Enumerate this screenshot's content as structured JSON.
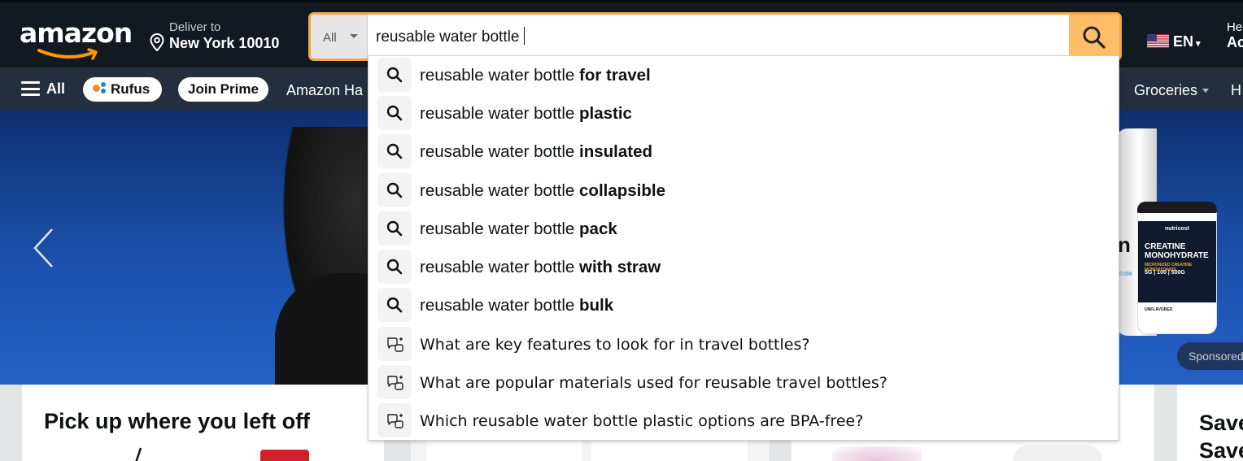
{
  "header": {
    "logo": "amazon",
    "deliver_line1": "Deliver to",
    "deliver_line2": "New York 10010",
    "search_category": "All",
    "search_value": "reusable water bottle",
    "language": "EN",
    "account_line1": "He",
    "account_line2": "Ac"
  },
  "subnav": {
    "all_label": "All",
    "rufus_label": "Rufus",
    "prime_label": "Join Prime",
    "link_amazon": "Amazon Ha",
    "link_groceries": "Groceries",
    "link_cut": "H"
  },
  "hero": {
    "sponsored_label": "Sponsored",
    "product_brand": "nutricost",
    "product_name_1": "CREATINE",
    "product_name_2": "MONOHYDRATE",
    "product_sub": "MICRONIZED CREATINE MONOHYDRATE",
    "product_boxes": "5G | 100 | 500G",
    "product_flavor": "UNFLAVORED",
    "back_tub_letter": "n",
    "back_tub_text": "trate"
  },
  "cards": {
    "card1_title": "Pick up where you left off",
    "card4_title_line1": "Save",
    "card4_title_line2": "Save"
  },
  "suggestions": [
    {
      "base": "reusable water bottle",
      "bold": "for travel",
      "icon": "search-icon"
    },
    {
      "base": "reusable water bottle",
      "bold": "plastic",
      "icon": "search-icon"
    },
    {
      "base": "reusable water bottle",
      "bold": "insulated",
      "icon": "search-icon"
    },
    {
      "base": "reusable water bottle",
      "bold": "collapsible",
      "icon": "search-icon"
    },
    {
      "base": "reusable water bottle",
      "bold": "pack",
      "icon": "search-icon"
    },
    {
      "base": "reusable water bottle",
      "bold": "with straw",
      "icon": "search-icon"
    },
    {
      "base": "reusable water bottle",
      "bold": "bulk",
      "icon": "search-icon"
    }
  ],
  "ai_suggestions": [
    {
      "text": "What are key features to look for in travel bottles?",
      "icon": "rufus-chat-icon"
    },
    {
      "text": "What are popular materials used for reusable travel bottles?",
      "icon": "rufus-chat-icon"
    },
    {
      "text": "Which reusable water bottle plastic options are BPA-free?",
      "icon": "rufus-chat-icon"
    }
  ],
  "colors": {
    "nav_bg": "#131921",
    "subnav_bg": "#232f3e",
    "search_button": "#febd69",
    "search_focus_border": "#f3a847",
    "logo_smile": "#ff9900"
  }
}
